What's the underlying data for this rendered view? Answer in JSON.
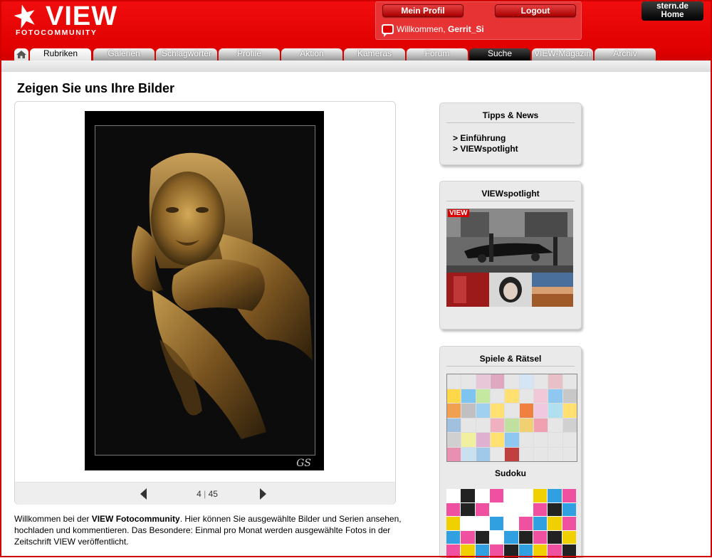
{
  "header": {
    "logo_text": "VIEW",
    "logo_sub": "FOTOCOMMUNITY",
    "profile_button": "Mein Profil",
    "logout_button": "Logout",
    "welcome_prefix": "Willkommen,",
    "username": "Gerrit_Si",
    "stern_line1": "stern.de",
    "stern_line2": "Home"
  },
  "nav": {
    "tabs": [
      "Rubriken",
      "Galerien",
      "Schlagwörter",
      "Profile",
      "Aktion",
      "Kameras",
      "Forum",
      "Suche",
      "VIEW-Magazin",
      "Archiv"
    ],
    "active": "Rubriken",
    "dark": "Suche"
  },
  "main": {
    "title": "Zeigen Sie uns Ihre Bilder",
    "photo_signature": "GS",
    "pager_current": "4",
    "pager_total": "45",
    "intro": {
      "p1": "Willkommen bei der ",
      "brand": "VIEW Fotocommunity",
      "p2": ". Hier können Sie ausgewählte Bilder und Serien ansehen, hochladen und kommentieren. Das Besondere: Einmal pro Monat werden ausgewählte Fotos in der Zeitschrift VIEW veröffentlicht."
    }
  },
  "sidebar": {
    "tipps_title": "Tipps & News",
    "tipps_links": [
      "> Einführung",
      "> VIEWspotlight"
    ],
    "spotlight_title": "VIEWspotlight",
    "spotlight_logo": "VIEW",
    "spiele_title": "Spiele & Rätsel",
    "sudoku_label": "Sudoku"
  },
  "colors": {
    "brand_red": "#e00000",
    "gold": "#b8862f"
  }
}
